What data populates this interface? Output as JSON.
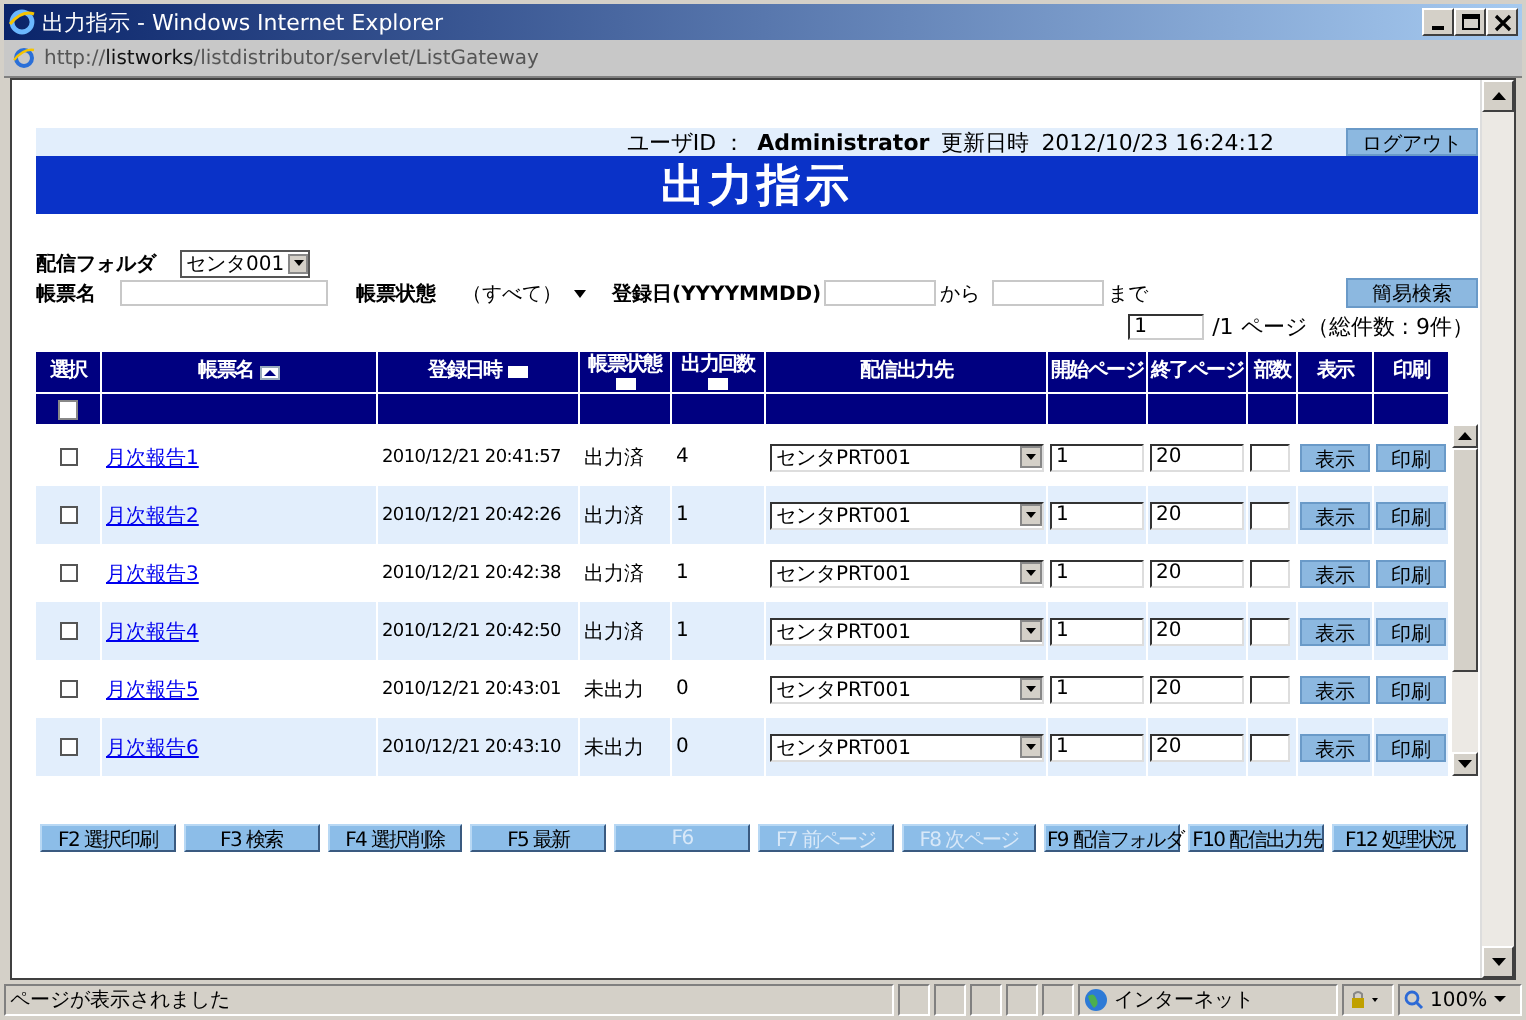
{
  "window": {
    "title": "出力指示 - Windows Internet Explorer"
  },
  "address": "http://**listworks**/listdistributor/servlet/ListGateway",
  "header": {
    "user_label": "ユーザID ：",
    "user": "Administrator",
    "updated_label": "更新日時",
    "updated": "2012/10/23 16:24:12",
    "logout": "ログアウト",
    "title": "出力指示"
  },
  "filters": {
    "folder_label": "配信フォルダ",
    "folder": "センタ001",
    "name_label": "帳票名",
    "status_label": "帳票状態",
    "status": "（すべて）",
    "date_label": "登録日(YYYYMMDD)",
    "from": "から",
    "to": "まで",
    "search": "簡易検索"
  },
  "pager": {
    "page": "1",
    "total": "/1  ページ（総件数 : 9件）"
  },
  "table": {
    "columns": [
      {
        "label": "選択",
        "sortable": false,
        "sorted": false
      },
      {
        "label": "帳票名",
        "sortable": true,
        "sorted": true
      },
      {
        "label": "登録日時",
        "sortable": true,
        "sorted": false
      },
      {
        "label": "帳票状態",
        "sortable": true,
        "sorted": false
      },
      {
        "label": "出力回数",
        "sortable": true,
        "sorted": false
      },
      {
        "label": "配信出力先",
        "sortable": false,
        "sorted": false
      },
      {
        "label": "開始ページ",
        "sortable": false,
        "sorted": false
      },
      {
        "label": "終了ページ",
        "sortable": false,
        "sorted": false
      },
      {
        "label": "部数",
        "sortable": false,
        "sorted": false
      },
      {
        "label": "表示",
        "sortable": false,
        "sorted": false
      },
      {
        "label": "印刷",
        "sortable": false,
        "sorted": false
      }
    ],
    "select_all": {
      "checked": false
    },
    "rows": [
      {
        "checked": false,
        "name": "月次報告1",
        "date": "2010/12/21 20:41:57",
        "status": "出力済",
        "count": "4",
        "destination": "センタPRT001",
        "start": "1",
        "end": "20",
        "view": "表示",
        "print": "印刷"
      },
      {
        "checked": false,
        "name": "月次報告2",
        "date": "2010/12/21 20:42:26",
        "status": "出力済",
        "count": "1",
        "destination": "センタPRT001",
        "start": "1",
        "end": "20",
        "view": "表示",
        "print": "印刷"
      },
      {
        "checked": false,
        "name": "月次報告3",
        "date": "2010/12/21 20:42:38",
        "status": "出力済",
        "count": "1",
        "destination": "センタPRT001",
        "start": "1",
        "end": "20",
        "view": "表示",
        "print": "印刷"
      },
      {
        "checked": false,
        "name": "月次報告4",
        "date": "2010/12/21 20:42:50",
        "status": "出力済",
        "count": "1",
        "destination": "センタPRT001",
        "start": "1",
        "end": "20",
        "view": "表示",
        "print": "印刷"
      },
      {
        "checked": false,
        "name": "月次報告5",
        "date": "2010/12/21 20:43:01",
        "status": "未出力",
        "count": "0",
        "destination": "センタPRT001",
        "start": "1",
        "end": "20",
        "view": "表示",
        "print": "印刷"
      },
      {
        "checked": false,
        "name": "月次報告6",
        "date": "2010/12/21 20:43:10",
        "status": "未出力",
        "count": "0",
        "destination": "センタPRT001",
        "start": "1",
        "end": "20",
        "view": "表示",
        "print": "印刷"
      }
    ]
  },
  "function_keys": [
    {
      "label": "F2 選択印刷",
      "disabled": false
    },
    {
      "label": "F3 検索",
      "disabled": false
    },
    {
      "label": "F4 選択削除",
      "disabled": false
    },
    {
      "label": "F5 最新",
      "disabled": false
    },
    {
      "label": "F6",
      "disabled": true
    },
    {
      "label": "F7 前ページ",
      "disabled": true
    },
    {
      "label": "F8 次ページ",
      "disabled": true
    },
    {
      "label": "F9 配信フォルダ",
      "disabled": false
    },
    {
      "label": "F10 配信出力先",
      "disabled": false
    },
    {
      "label": "F12 処理状況",
      "disabled": false
    }
  ],
  "status_bar": {
    "message": "ページが表示されました",
    "zone": "インターネット",
    "zoom": "100%"
  }
}
